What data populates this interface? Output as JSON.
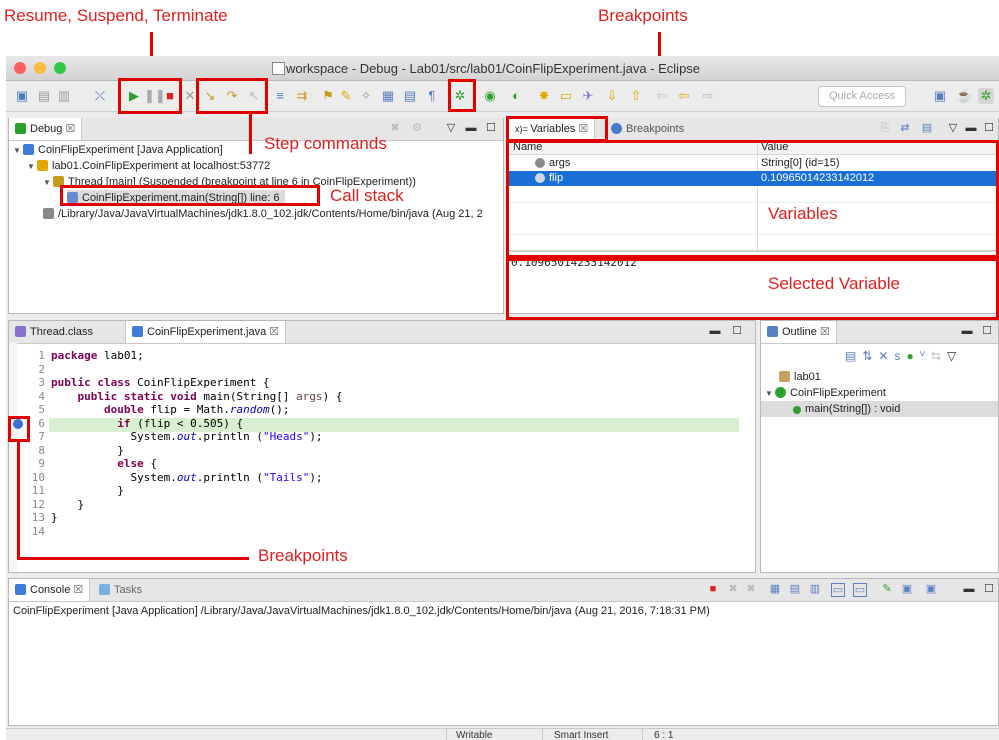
{
  "callouts": {
    "resume_suspend_terminate": "Resume, Suspend, Terminate",
    "breakpoints_top": "Breakpoints",
    "step_commands": "Step commands",
    "call_stack": "Call stack",
    "variables": "Variables",
    "selected_variable": "Selected Variable",
    "breakpoints_bottom": "Breakpoints"
  },
  "window": {
    "title": "workspace - Debug - Lab01/src/lab01/CoinFlipExperiment.java - Eclipse",
    "quick_access": "Quick Access"
  },
  "debug_view": {
    "tab_label": "Debug",
    "tree": [
      "CoinFlipExperiment [Java Application]",
      "lab01.CoinFlipExperiment at localhost:53772",
      "Thread [main] (Suspended (breakpoint at line 6 in CoinFlipExperiment))",
      "CoinFlipExperiment.main(String[]) line: 6",
      "/Library/Java/JavaVirtualMachines/jdk1.8.0_102.jdk/Contents/Home/bin/java (Aug 21, 2"
    ]
  },
  "variables_view": {
    "tab_variables": "Variables",
    "tab_breakpoints": "Breakpoints",
    "col_name": "Name",
    "col_value": "Value",
    "rows": [
      {
        "name": "args",
        "value": "String[0]  (id=15)"
      },
      {
        "name": "flip",
        "value": "0.10965014233142012"
      }
    ],
    "detail_value": "0.10965014233142012"
  },
  "editor": {
    "tab_thread": "Thread.class",
    "tab_file": "CoinFlipExperiment.java",
    "line_numbers": [
      "1",
      "2",
      "3",
      "4",
      "5",
      "6",
      "7",
      "8",
      "9",
      "10",
      "11",
      "12",
      "13",
      "14"
    ]
  },
  "outline_view": {
    "tab_label": "Outline",
    "package": "lab01",
    "class_name": "CoinFlipExperiment",
    "method": "main(String[]) : void"
  },
  "console_view": {
    "tab_console": "Console",
    "tab_tasks": "Tasks",
    "text": "CoinFlipExperiment [Java Application] /Library/Java/JavaVirtualMachines/jdk1.8.0_102.jdk/Contents/Home/bin/java (Aug 21, 2016, 7:18:31 PM)"
  },
  "status": {
    "writable": "Writable",
    "insert_mode": "Smart Insert",
    "position": "6 : 1"
  },
  "colors": {
    "annotation": "#e00000",
    "selection": "#1a6fd5",
    "keyword": "#7f0055",
    "string": "#2a00ff"
  }
}
